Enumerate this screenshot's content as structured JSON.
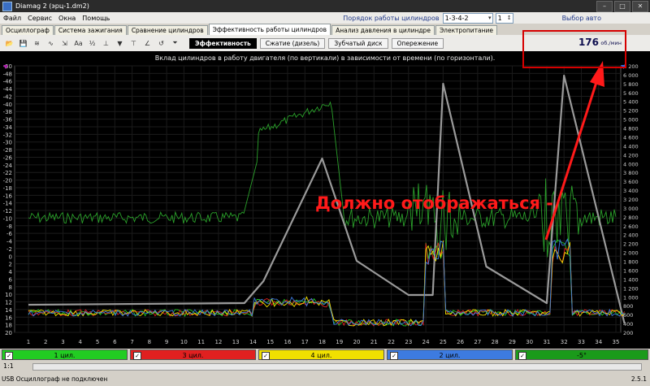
{
  "window": {
    "title": "Diamag 2 (эрц-1.dm2)"
  },
  "menu": {
    "items": [
      "Файл",
      "Сервис",
      "Окна",
      "Помощь"
    ]
  },
  "firing_order": {
    "label": "Порядок работы цилиндров",
    "value": "1-3-4-2",
    "cylinder": "1"
  },
  "select_car": "Выбор авто",
  "tabs": [
    "Осциллограф",
    "Система зажигания",
    "Сравнение цилиндров",
    "Эффективность работы цилиндров",
    "Анализ давления в цилиндре",
    "Электропитание"
  ],
  "subtabs": [
    "Эффективность",
    "Сжатие (дизель)",
    "Зубчатый диск",
    "Опережение"
  ],
  "rpm": {
    "value": "176",
    "unit": "об./мин"
  },
  "chart": {
    "title": "Вклад цилиндров в работу двигателя (по вертикали) в зависимости от времени (по горизонтали).",
    "left_ticks": [
      "-50",
      "-48",
      "-46",
      "-44",
      "-42",
      "-40",
      "-38",
      "-36",
      "-34",
      "-32",
      "-30",
      "-28",
      "-26",
      "-24",
      "-22",
      "-20",
      "-18",
      "-16",
      "-14",
      "-12",
      "-10",
      "-8",
      "-6",
      "-4",
      "-2",
      "0",
      "2",
      "4",
      "6",
      "8",
      "10",
      "12",
      "14",
      "16",
      "18",
      "20"
    ],
    "right_ticks": [
      "6 200",
      "6 000",
      "5 800",
      "5 600",
      "5 400",
      "5 200",
      "5 000",
      "4 800",
      "4 600",
      "4 400",
      "4 200",
      "4 000",
      "3 800",
      "3 600",
      "3 400",
      "3 200",
      "3 000",
      "2 800",
      "2 600",
      "2 400",
      "2 200",
      "2 000",
      "1 800",
      "1 600",
      "1 400",
      "1 200",
      "1 000",
      "800",
      "600",
      "400",
      "200"
    ],
    "bottom_ticks": [
      "1",
      "2",
      "3",
      "4",
      "5",
      "6",
      "7",
      "8",
      "9",
      "10",
      "11",
      "12",
      "13",
      "14",
      "15",
      "16",
      "17",
      "18",
      "19",
      "20",
      "21",
      "22",
      "23",
      "24",
      "25",
      "26",
      "27",
      "28",
      "29",
      "30",
      "31",
      "32",
      "33",
      "34",
      "35"
    ]
  },
  "annotation": "Должно отображаться -",
  "cylinders": [
    {
      "label": "1 цил.",
      "color": "#22cc22"
    },
    {
      "label": "3 цил.",
      "color": "#e02020"
    },
    {
      "label": "4 цил.",
      "color": "#f0e000"
    },
    {
      "label": "2 цил.",
      "color": "#3d7be0"
    },
    {
      "label": "-5°",
      "color": "#1a9a1a"
    }
  ],
  "status": {
    "zoom": "1:1",
    "text": "USB Осциллограф не подключен",
    "version": "2.5.1"
  }
}
